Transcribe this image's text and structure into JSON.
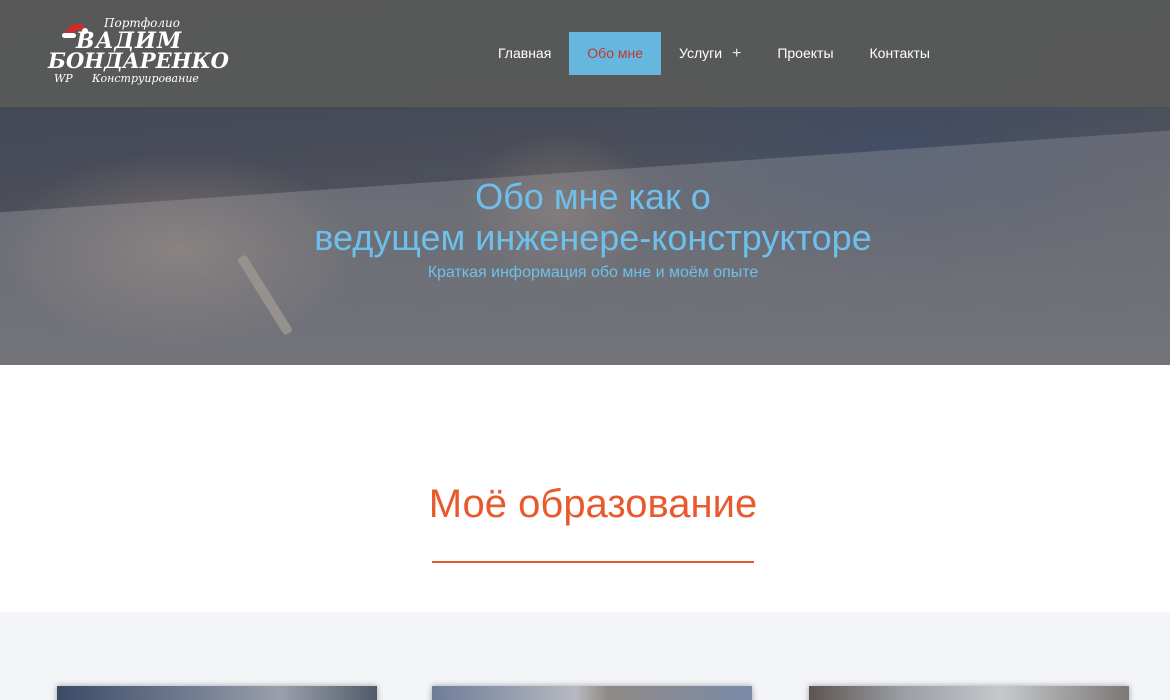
{
  "logo": {
    "top_text": "Портфолио",
    "name_line1": "ВАДИМ",
    "name_line2": "БОНДАРЕНКО",
    "wp_text": "WP",
    "bottom_text": "Конструирование"
  },
  "nav": {
    "items": [
      {
        "label": "Главная",
        "active": false,
        "has_submenu": false
      },
      {
        "label": "Обо мне",
        "active": true,
        "has_submenu": false
      },
      {
        "label": "Услуги",
        "active": false,
        "has_submenu": true
      },
      {
        "label": "Проекты",
        "active": false,
        "has_submenu": false
      },
      {
        "label": "Контакты",
        "active": false,
        "has_submenu": false
      }
    ],
    "submenu_symbol": "+"
  },
  "hero": {
    "title_line1": "Обо мне как о",
    "title_line2": "ведущем инженере-конструкторе",
    "subtitle": "Краткая информация обо мне и моём опыте"
  },
  "education": {
    "title": "Моё образование"
  },
  "colors": {
    "accent_blue": "#66b7e0",
    "hero_text": "#6ec0ec",
    "section_orange": "#e8592b",
    "header_bg": "#585858"
  }
}
